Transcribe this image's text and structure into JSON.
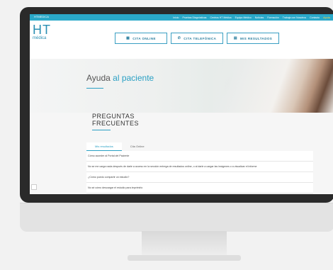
{
  "topbar": {
    "brand": "HTMEDICA",
    "nav": [
      "Inicio",
      "Pruebas Diagnósticas",
      "Centros HT Médica",
      "Equipo Médico",
      "Noticias",
      "Formación",
      "Trabaja con Nosotros",
      "Contacto",
      "Ayuda"
    ]
  },
  "logo": {
    "ht": "HT",
    "med": "médica"
  },
  "actions": [
    {
      "icon": "calendar-icon",
      "label": "CITA ONLINE"
    },
    {
      "icon": "phone-icon",
      "label": "CITA TELEFÓNICA"
    },
    {
      "icon": "document-icon",
      "label": "MIS RESULTADOS"
    }
  ],
  "hero": {
    "title_plain": "Ayuda",
    "title_accent": "al paciente"
  },
  "faq": {
    "title_line1": "PREGUNTAS",
    "title_line2": "FRECUENTES",
    "tabs": [
      "Mis resultados",
      "Cita Online"
    ],
    "questions": [
      "Cómo acceder al Portal del Paciente",
      "No se me carga nada después de darle a acceso en la sección entrega de resultados online, o al darle a cargar las imágenes o a visualizar el informe",
      "¿Cómo puedo compartir un estudio?",
      "No sé cómo descargar el estudio para imprimirlo"
    ]
  },
  "colors": {
    "accent": "#2aa8c8",
    "highlight": "#ffd23f"
  }
}
